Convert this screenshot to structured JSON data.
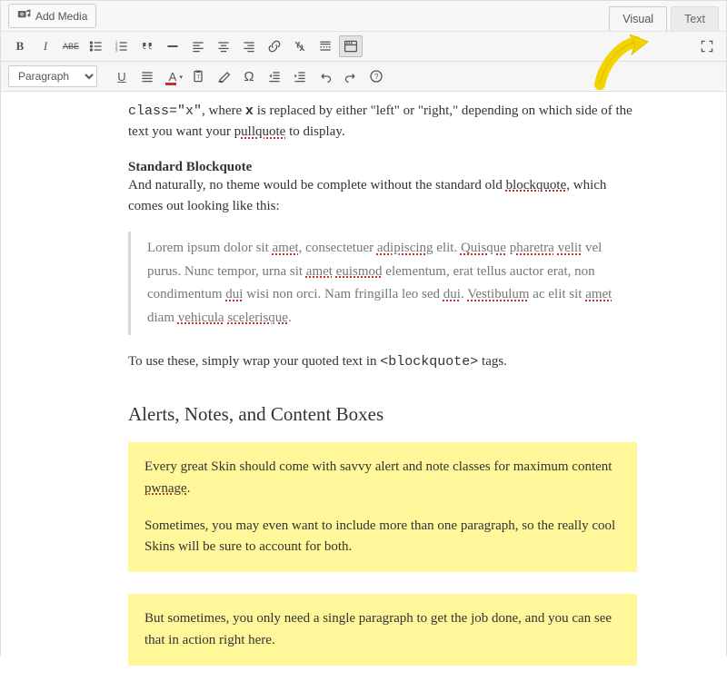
{
  "topbar": {
    "add_media_label": "Add Media"
  },
  "tabs": {
    "visual": "Visual",
    "text": "Text"
  },
  "toolbar": {
    "format_selected": "Paragraph",
    "b": "B",
    "i": "I",
    "abe": "ABE",
    "u_label": "U",
    "a_label": "A",
    "omega": "Ω",
    "help": "?"
  },
  "icons": {
    "camera_music": "camera-music-icon",
    "bullet_list": "bullet-list-icon",
    "number_list": "number-list-icon",
    "quote": "quote-icon",
    "hr": "hr-icon",
    "align_left": "align-left-icon",
    "align_center": "align-center-icon",
    "align_right": "align-right-icon",
    "link": "link-icon",
    "unlink": "unlink-icon",
    "more": "read-more-icon",
    "toolbar_toggle": "toolbar-toggle-icon",
    "fullscreen": "fullscreen-icon",
    "underline": "underline-icon",
    "justify": "justify-icon",
    "text_color": "text-color-icon",
    "paste_text": "paste-text-icon",
    "eraser": "clear-format-icon",
    "special_char": "special-char-icon",
    "outdent": "outdent-icon",
    "indent": "indent-icon",
    "undo": "undo-icon",
    "redo": "redo-icon",
    "help": "help-icon",
    "expand": "expand-icon"
  },
  "content": {
    "lead_a": "class=\"x\"",
    "lead_b": ", where ",
    "lead_c": "x",
    "lead_d": " is replaced by either \"left\" or \"right,\" depending on which side of the text you want your ",
    "lead_e": "pullquote",
    "lead_f": " to display.",
    "h_block": "Standard Blockquote",
    "block_p1a": "And naturally, no theme would be complete without the standard old ",
    "block_p1b": "blockquote",
    "block_p1c": ", which comes out looking like this:",
    "bq_a": "Lorem ipsum dolor sit ",
    "bq_b": "amet",
    "bq_c": ", consectetuer ",
    "bq_d": "adipiscing",
    "bq_e": " elit. ",
    "bq_f": "Quisque",
    "bq_g": " ",
    "bq_h": "pharetra",
    "bq_i": " ",
    "bq_j": "velit",
    "bq_k": " vel purus. Nunc tempor, urna sit ",
    "bq_l": "amet",
    "bq_m": " ",
    "bq_n": "euismod",
    "bq_o": " elementum, erat tellus auctor erat, non condimentum ",
    "bq_p": "dui",
    "bq_q": " wisi non orci. Nam fringilla leo sed ",
    "bq_r": "dui",
    "bq_s": ". ",
    "bq_t": "Vestibulum",
    "bq_u": " ac elit sit ",
    "bq_v": "amet",
    "bq_w": " diam ",
    "bq_x": "vehicula",
    "bq_y": " ",
    "bq_z": "scelerisque",
    "bq_end": ".",
    "after_bq_a": "To use these, simply wrap your quoted text in ",
    "after_bq_b": "<blockquote>",
    "after_bq_c": " tags.",
    "h_alerts": "Alerts, Notes, and Content Boxes",
    "alert1_p1_a": "Every great Skin should come with savvy alert and note classes for maximum content ",
    "alert1_p1_b": "pwnage",
    "alert1_p1_c": ".",
    "alert1_p2": "Sometimes, you may even want to include more than one paragraph, so the really cool Skins will be sure to account for both.",
    "alert2_p1": "But sometimes, you only need a single paragraph to get the job done, and you can see that in action right here."
  }
}
